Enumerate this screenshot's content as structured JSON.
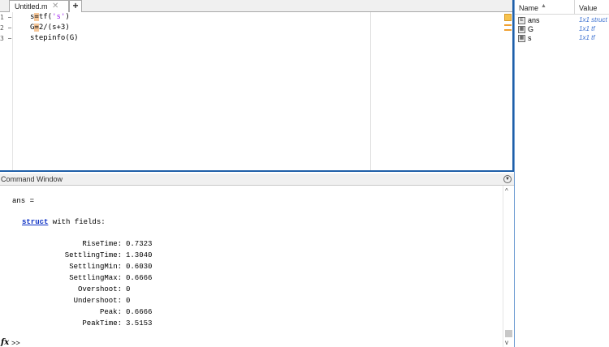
{
  "editor": {
    "tab_label": "Untitled.m",
    "tab_close_glyph": "✕",
    "tab_add_glyph": "+",
    "lines": [
      {
        "num": "1",
        "pre": "s",
        "hl": "=",
        "post": "tf(",
        "str": "'s'",
        "end": ")"
      },
      {
        "num": "2",
        "pre": "G",
        "hl": "=",
        "post": "2/(s+3)",
        "str": "",
        "end": ""
      },
      {
        "num": "3",
        "pre": "stepinfo(G)",
        "hl": "",
        "post": "",
        "str": "",
        "end": ""
      }
    ]
  },
  "command_window": {
    "title": "Command Window",
    "ans_line": "ans =",
    "struct_word": "struct",
    "struct_rest": " with fields:",
    "fields": [
      {
        "key": "RiseTime:",
        "value": "0.7323"
      },
      {
        "key": "SettlingTime:",
        "value": "1.3040"
      },
      {
        "key": "SettlingMin:",
        "value": "0.6030"
      },
      {
        "key": "SettlingMax:",
        "value": "0.6666"
      },
      {
        "key": "Overshoot:",
        "value": "0"
      },
      {
        "key": "Undershoot:",
        "value": "0"
      },
      {
        "key": "Peak:",
        "value": "0.6666"
      },
      {
        "key": "PeakTime:",
        "value": "3.5153"
      }
    ],
    "fx_label": "fx",
    "prompt": ">>"
  },
  "workspace": {
    "col_name": "Name",
    "sort_glyph": "▲",
    "col_value": "Value",
    "vars": [
      {
        "name": "ans",
        "value": "1x1 struct",
        "icon": "struct-icon"
      },
      {
        "name": "G",
        "value": "1x1 tf",
        "icon": "tf-icon"
      },
      {
        "name": "s",
        "value": "1x1 tf",
        "icon": "tf-icon"
      }
    ]
  },
  "colors": {
    "accent": "#1f5fa8",
    "string": "#a020f0",
    "link": "#0b2fc4",
    "var_value": "#3a6fd0"
  }
}
